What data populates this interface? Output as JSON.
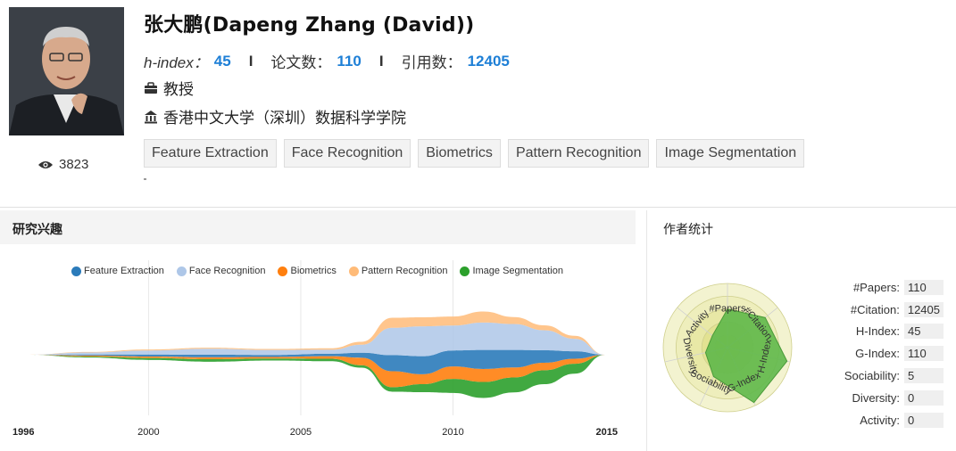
{
  "profile": {
    "name": "张大鹏(Dapeng Zhang (David))",
    "views": "3823",
    "stats": [
      {
        "label": "h-index：",
        "value": "45"
      },
      {
        "label": "论文数：",
        "value": "110"
      },
      {
        "label": "引用数：",
        "value": "12405"
      }
    ],
    "separator": "I",
    "title": "教授",
    "institution": "香港中文大学（深圳）数据科学学院",
    "tags": [
      "Feature Extraction",
      "Face Recognition",
      "Biometrics",
      "Pattern Recognition",
      "Image Segmentation"
    ]
  },
  "interest": {
    "title": "研究兴趣",
    "legend": [
      {
        "name": "Feature Extraction",
        "color": "#2b7bba"
      },
      {
        "name": "Face Recognition",
        "color": "#aec7e8"
      },
      {
        "name": "Biometrics",
        "color": "#ff7f0e"
      },
      {
        "name": "Pattern Recognition",
        "color": "#ffbb78"
      },
      {
        "name": "Image Segmentation",
        "color": "#2ca02c"
      }
    ]
  },
  "author_stats": {
    "title": "作者统计",
    "metrics": [
      {
        "label": "#Papers:",
        "value": "110"
      },
      {
        "label": "#Citation:",
        "value": "12405"
      },
      {
        "label": "H-Index:",
        "value": "45"
      },
      {
        "label": "G-Index:",
        "value": "110"
      },
      {
        "label": "Sociability:",
        "value": "5"
      },
      {
        "label": "Diversity:",
        "value": "0"
      },
      {
        "label": "Activity:",
        "value": "0"
      }
    ],
    "radar_axes": [
      "#Papers",
      "#Citation",
      "H-Index",
      "G-Index",
      "Sociability",
      "Diversity",
      "Activity"
    ],
    "radar_levels": [
      0.6,
      0.75,
      0.95,
      0.95,
      0.5,
      0.35,
      0.3
    ]
  },
  "chart_data": [
    {
      "type": "area",
      "subtype": "streamgraph",
      "x": [
        1996,
        1998,
        2000,
        2002,
        2004,
        2006,
        2007,
        2008,
        2009,
        2010,
        2011,
        2012,
        2013,
        2014,
        2015
      ],
      "x_tick_labels": [
        "1996",
        "2000",
        "2005",
        "2010",
        "2015"
      ],
      "series": [
        {
          "name": "Feature Extraction",
          "values": [
            0,
            0.2,
            0.4,
            0.5,
            0.4,
            0.5,
            1.0,
            3.2,
            3.6,
            3.2,
            3.8,
            3.5,
            2.5,
            1.5,
            0
          ]
        },
        {
          "name": "Face Recognition",
          "values": [
            0,
            0.4,
            0.8,
            1.2,
            1.0,
            0.8,
            1.6,
            5.5,
            6.0,
            5.0,
            5.5,
            5.2,
            4.0,
            2.5,
            0
          ]
        },
        {
          "name": "Biometrics",
          "values": [
            0,
            0.2,
            0.3,
            0.4,
            0.3,
            0.5,
            1.5,
            3.2,
            2.0,
            2.5,
            2.6,
            2.0,
            1.5,
            1.0,
            0
          ]
        },
        {
          "name": "Pattern Recognition",
          "values": [
            0,
            0.1,
            0.2,
            0.2,
            0.2,
            0.3,
            0.6,
            2.0,
            1.8,
            1.8,
            2.2,
            1.4,
            1.0,
            0.6,
            0
          ]
        },
        {
          "name": "Image Segmentation",
          "values": [
            0,
            0.2,
            0.4,
            0.5,
            0.4,
            0.5,
            0.5,
            0.9,
            1.6,
            2.8,
            3.2,
            3.0,
            2.8,
            2.0,
            0
          ]
        }
      ],
      "grid": true,
      "legend": "top"
    }
  ]
}
